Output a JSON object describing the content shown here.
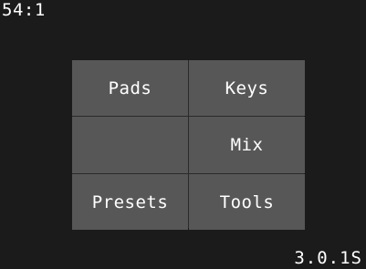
{
  "status": {
    "position": "54:1",
    "version": "3.0.1S"
  },
  "menu": {
    "cells": [
      {
        "label": "Pads"
      },
      {
        "label": "Keys"
      },
      {
        "label": ""
      },
      {
        "label": "Mix"
      },
      {
        "label": "Presets"
      },
      {
        "label": "Tools"
      }
    ]
  },
  "colors": {
    "background": "#1b1b1b",
    "cell": "#575757",
    "grid_line": "#2a2a2a",
    "text": "#ffffff"
  }
}
